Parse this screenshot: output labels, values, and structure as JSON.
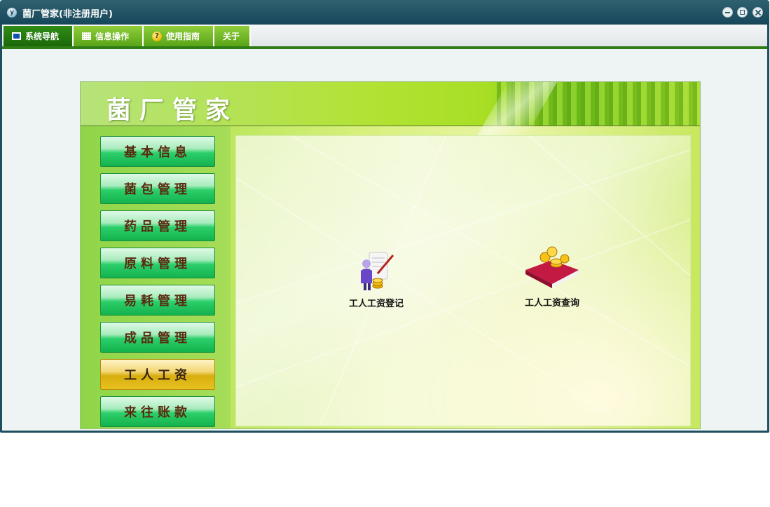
{
  "window": {
    "title": "菌厂管家(非注册用户)",
    "app_icon": "y-logo-icon",
    "controls": [
      "minimize-icon",
      "restore-icon",
      "close-icon"
    ]
  },
  "menubar": {
    "tabs": [
      {
        "label": "系统导航",
        "icon": "monitor-icon",
        "active": true
      },
      {
        "label": "信息操作",
        "icon": "grid-icon",
        "active": false
      },
      {
        "label": "使用指南",
        "icon": "help-icon",
        "active": false
      },
      {
        "label": "关于",
        "icon": "",
        "active": false
      }
    ]
  },
  "panel": {
    "title": "菌厂管家",
    "nav": [
      {
        "label": "基本信息",
        "active": false
      },
      {
        "label": "菌包管理",
        "active": false
      },
      {
        "label": "药品管理",
        "active": false
      },
      {
        "label": "原料管理",
        "active": false
      },
      {
        "label": "易耗管理",
        "active": false
      },
      {
        "label": "成品管理",
        "active": false
      },
      {
        "label": "工人工资",
        "active": true
      },
      {
        "label": "来往账款",
        "active": false
      }
    ],
    "tiles": [
      {
        "label": "工人工资登记",
        "icon": "worker-register-icon"
      },
      {
        "label": "工人工资查询",
        "icon": "ledger-coins-icon"
      }
    ]
  },
  "colors": {
    "titlebar": "#1e4f5e",
    "tab_active": "#1a6809",
    "tab": "#5aa418",
    "nav_button": "#14b24e",
    "nav_button_active": "#d8ad0f"
  }
}
